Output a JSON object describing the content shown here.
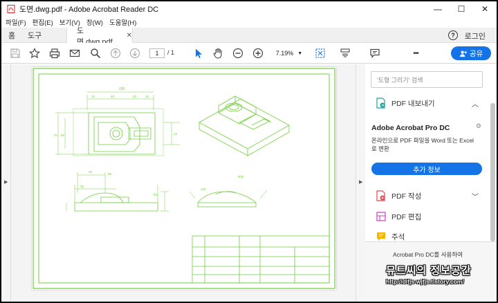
{
  "window": {
    "title": "도면.dwg.pdf - Adobe Acrobat Reader DC",
    "controls": {
      "minimize": "—",
      "maximize": "☐",
      "close": "✕"
    }
  },
  "menu": [
    "파일(F)",
    "편집(E)",
    "보기(V)",
    "창(W)",
    "도움말(H)"
  ],
  "tabs": {
    "home": "홈",
    "tools": "도구",
    "document": "도면.dwg.pdf",
    "close": "✕"
  },
  "header": {
    "help": "?",
    "login": "로그인"
  },
  "toolbar": {
    "page_current": "1",
    "page_total": "/ 1",
    "zoom": "7.19%",
    "share": "공유",
    "more": "•••"
  },
  "drawing": {
    "dim_top": "100",
    "dim_row": [
      "10",
      "40",
      "20",
      "15"
    ],
    "dim_left": "70",
    "dim_left2": "56",
    "dim_right": "14",
    "side_dims": [
      "28",
      "58",
      "25",
      "R4"
    ],
    "iso_dims": [
      "100",
      "R40"
    ]
  },
  "rightpane": {
    "search_placeholder": "'도형 그리기' 검색",
    "export_pdf": "PDF 내보내기",
    "promo_title": "Adobe Acrobat Pro DC",
    "promo_text": "온라인으로 PDF 파일을 Word 또는 Excel로 변환",
    "more_info": "추가 정보",
    "create_pdf": "PDF 작성",
    "edit_pdf": "PDF 편집",
    "comment": "주석",
    "bottom_text": "Acrobat Pro DC를 사용하여",
    "watermark": "뮤트씨의 정보공간",
    "watermark_url": "http://dlfjs-wjfjs.tistory.com/"
  },
  "colors": {
    "accent": "#1473e6",
    "drawing": "#6fcf3a"
  }
}
